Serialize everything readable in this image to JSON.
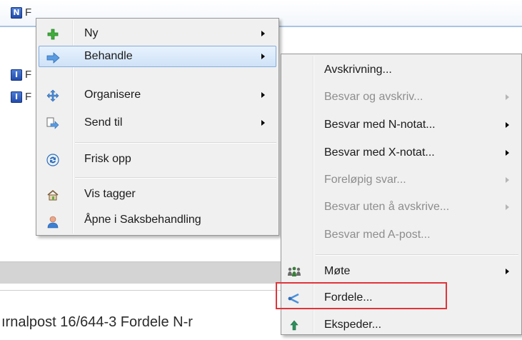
{
  "background": {
    "header_badge": "N",
    "row_badges": [
      "I",
      "I"
    ],
    "row_letters": [
      "F",
      "F",
      "F"
    ],
    "header_letter": "F",
    "title_text": "ırnalpost 16/644-3 Fordele N-r"
  },
  "main_menu": {
    "items": [
      {
        "label": "Ny",
        "icon": "plus-icon"
      },
      {
        "label": "Behandle",
        "icon": "forward-arrow-icon"
      },
      {
        "label": "Organisere",
        "icon": "move-arrows-icon"
      },
      {
        "label": "Send til",
        "icon": "send-to-icon"
      },
      {
        "label": "Frisk opp",
        "icon": "refresh-icon"
      },
      {
        "label": "Vis tagger",
        "icon": "tags-house-icon"
      },
      {
        "label": "Åpne i Saksbehandling",
        "icon": "person-icon"
      }
    ],
    "highlighted": "Behandle"
  },
  "sub_menu": {
    "items": [
      {
        "label": "Avskrivning...",
        "enabled": true
      },
      {
        "label": "Besvar og avskriv...",
        "enabled": false
      },
      {
        "label": "Besvar med N-notat...",
        "enabled": true
      },
      {
        "label": "Besvar med X-notat...",
        "enabled": true
      },
      {
        "label": "Foreløpig svar...",
        "enabled": false
      },
      {
        "label": "Besvar uten å avskrive...",
        "enabled": false
      },
      {
        "label": "Besvar med A-post...",
        "enabled": false
      },
      {
        "label": "Møte",
        "enabled": true,
        "icon": "meeting-people-icon"
      },
      {
        "label": "Fordele...",
        "enabled": true,
        "icon": "distribute-share-icon"
      },
      {
        "label": "Ekspeder...",
        "enabled": true,
        "icon": "dispatch-icon"
      }
    ],
    "outlined": "Fordele..."
  },
  "colors": {
    "highlight_border": "#84acdd",
    "outline_red": "#e0343a",
    "menu_bg": "#f0f0f0"
  }
}
